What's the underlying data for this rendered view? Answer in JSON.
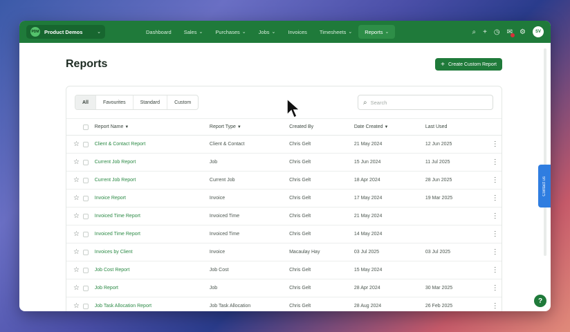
{
  "nav": {
    "org_name": "Product Demos",
    "org_badge": "PDM",
    "items": [
      {
        "label": "Dashboard",
        "has_menu": false
      },
      {
        "label": "Sales",
        "has_menu": true
      },
      {
        "label": "Purchases",
        "has_menu": true
      },
      {
        "label": "Jobs",
        "has_menu": true
      },
      {
        "label": "Invoices",
        "has_menu": false
      },
      {
        "label": "Timesheets",
        "has_menu": true
      },
      {
        "label": "Reports",
        "has_menu": true,
        "active": true
      }
    ],
    "avatar_initials": "SV",
    "icons": [
      "search-icon",
      "plus-icon",
      "clock-icon",
      "notifications-icon",
      "settings-icon"
    ]
  },
  "page": {
    "title": "Reports",
    "create_button": "Create Custom Report"
  },
  "filters": {
    "tabs": [
      "All",
      "Favourites",
      "Standard",
      "Custom"
    ],
    "active_tab": "All",
    "search_placeholder": "Search"
  },
  "table": {
    "columns": [
      "Report Name",
      "Report Type",
      "Created By",
      "Date Created",
      "Last Used"
    ],
    "rows": [
      {
        "name": "Client & Contact Report",
        "type": "Client & Contact",
        "created_by": "Chris Gelt",
        "date_created": "21 May 2024",
        "last_used": "12 Jun 2025"
      },
      {
        "name": "Current Job Report",
        "type": "Job",
        "created_by": "Chris Gelt",
        "date_created": "15 Jun 2024",
        "last_used": "11 Jul 2025"
      },
      {
        "name": "Current Job Report",
        "type": "Current Job",
        "created_by": "Chris Gelt",
        "date_created": "18 Apr 2024",
        "last_used": "28 Jun 2025"
      },
      {
        "name": "Invoice Report",
        "type": "Invoice",
        "created_by": "Chris Gelt",
        "date_created": "17 May 2024",
        "last_used": "19 Mar 2025"
      },
      {
        "name": "Invoiced Time Report",
        "type": "Invoiced Time",
        "created_by": "Chris Gelt",
        "date_created": "21 May 2024",
        "last_used": ""
      },
      {
        "name": "Invoiced Time Report",
        "type": "Invoiced Time",
        "created_by": "Chris Gelt",
        "date_created": "14 May 2024",
        "last_used": ""
      },
      {
        "name": "Invoices by Client",
        "type": "Invoice",
        "created_by": "Macaulay Hay",
        "date_created": "03 Jul 2025",
        "last_used": "03 Jul 2025"
      },
      {
        "name": "Job Cost Report",
        "type": "Job Cost",
        "created_by": "Chris Gelt",
        "date_created": "15 May 2024",
        "last_used": ""
      },
      {
        "name": "Job Report",
        "type": "Job",
        "created_by": "Chris Gelt",
        "date_created": "28 Apr 2024",
        "last_used": "30 Mar 2025"
      },
      {
        "name": "Job Task Allocation Report",
        "type": "Job Task Allocation",
        "created_by": "Chris Gelt",
        "date_created": "28 Aug 2024",
        "last_used": "26 Feb 2025"
      }
    ]
  },
  "side": {
    "contact_label": "Contact us",
    "help_label": "?"
  }
}
